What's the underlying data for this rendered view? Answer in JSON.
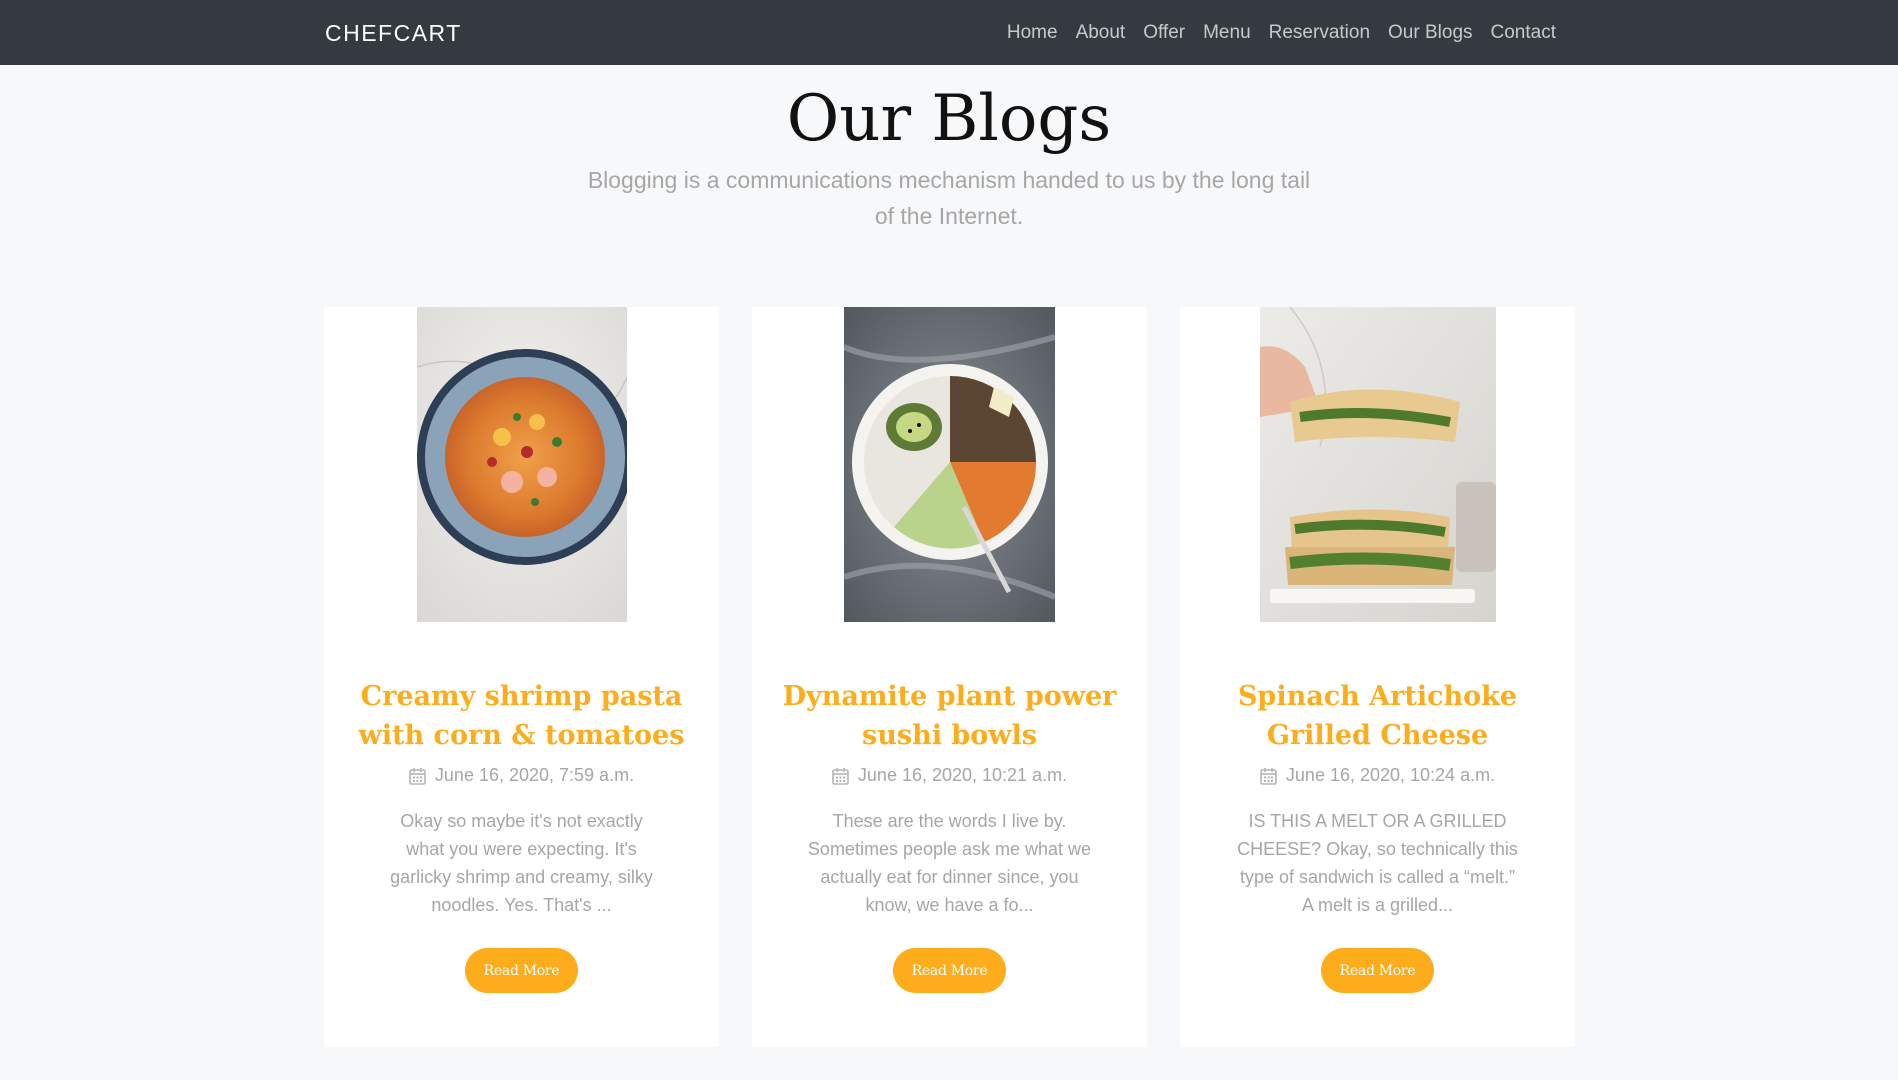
{
  "navbar": {
    "brand": "CHEFCART",
    "links": [
      "Home",
      "About",
      "Offer",
      "Menu",
      "Reservation",
      "Our Blogs",
      "Contact"
    ]
  },
  "section": {
    "title": "Our Blogs",
    "subtitle": "Blogging is a communications mechanism handed to us by the long tail of the Internet."
  },
  "posts": [
    {
      "title": "Creamy shrimp pasta with corn & tomatoes",
      "date": "June 16, 2020, 7:59 a.m.",
      "excerpt": "Okay so maybe it's not exactly what you were expecting. It's garlicky shrimp and creamy, silky noodles. Yes. That's ...",
      "button": "Read More",
      "image": "shrimp-pasta-photo"
    },
    {
      "title": "Dynamite plant power sushi bowls",
      "date": "June 16, 2020, 10:21 a.m.",
      "excerpt": "These are the words I live by. Sometimes people ask me what we actually eat for dinner since, you know, we have a fo...",
      "button": "Read More",
      "image": "sushi-bowl-photo"
    },
    {
      "title": "Spinach Artichoke Grilled Cheese",
      "date": "June 16, 2020, 10:24 a.m.",
      "excerpt": "IS THIS A MELT OR A GRILLED CHEESE? Okay, so technically this type of sandwich is called a “melt.” A melt is a grilled...",
      "button": "Read More",
      "image": "grilled-cheese-photo"
    }
  ],
  "colors": {
    "navbar": "#343a40",
    "accent": "#fdac1c",
    "page_bg": "#f7f8fa",
    "muted_text": "#a6a6a6"
  },
  "icons": {
    "date": "calendar-icon"
  }
}
